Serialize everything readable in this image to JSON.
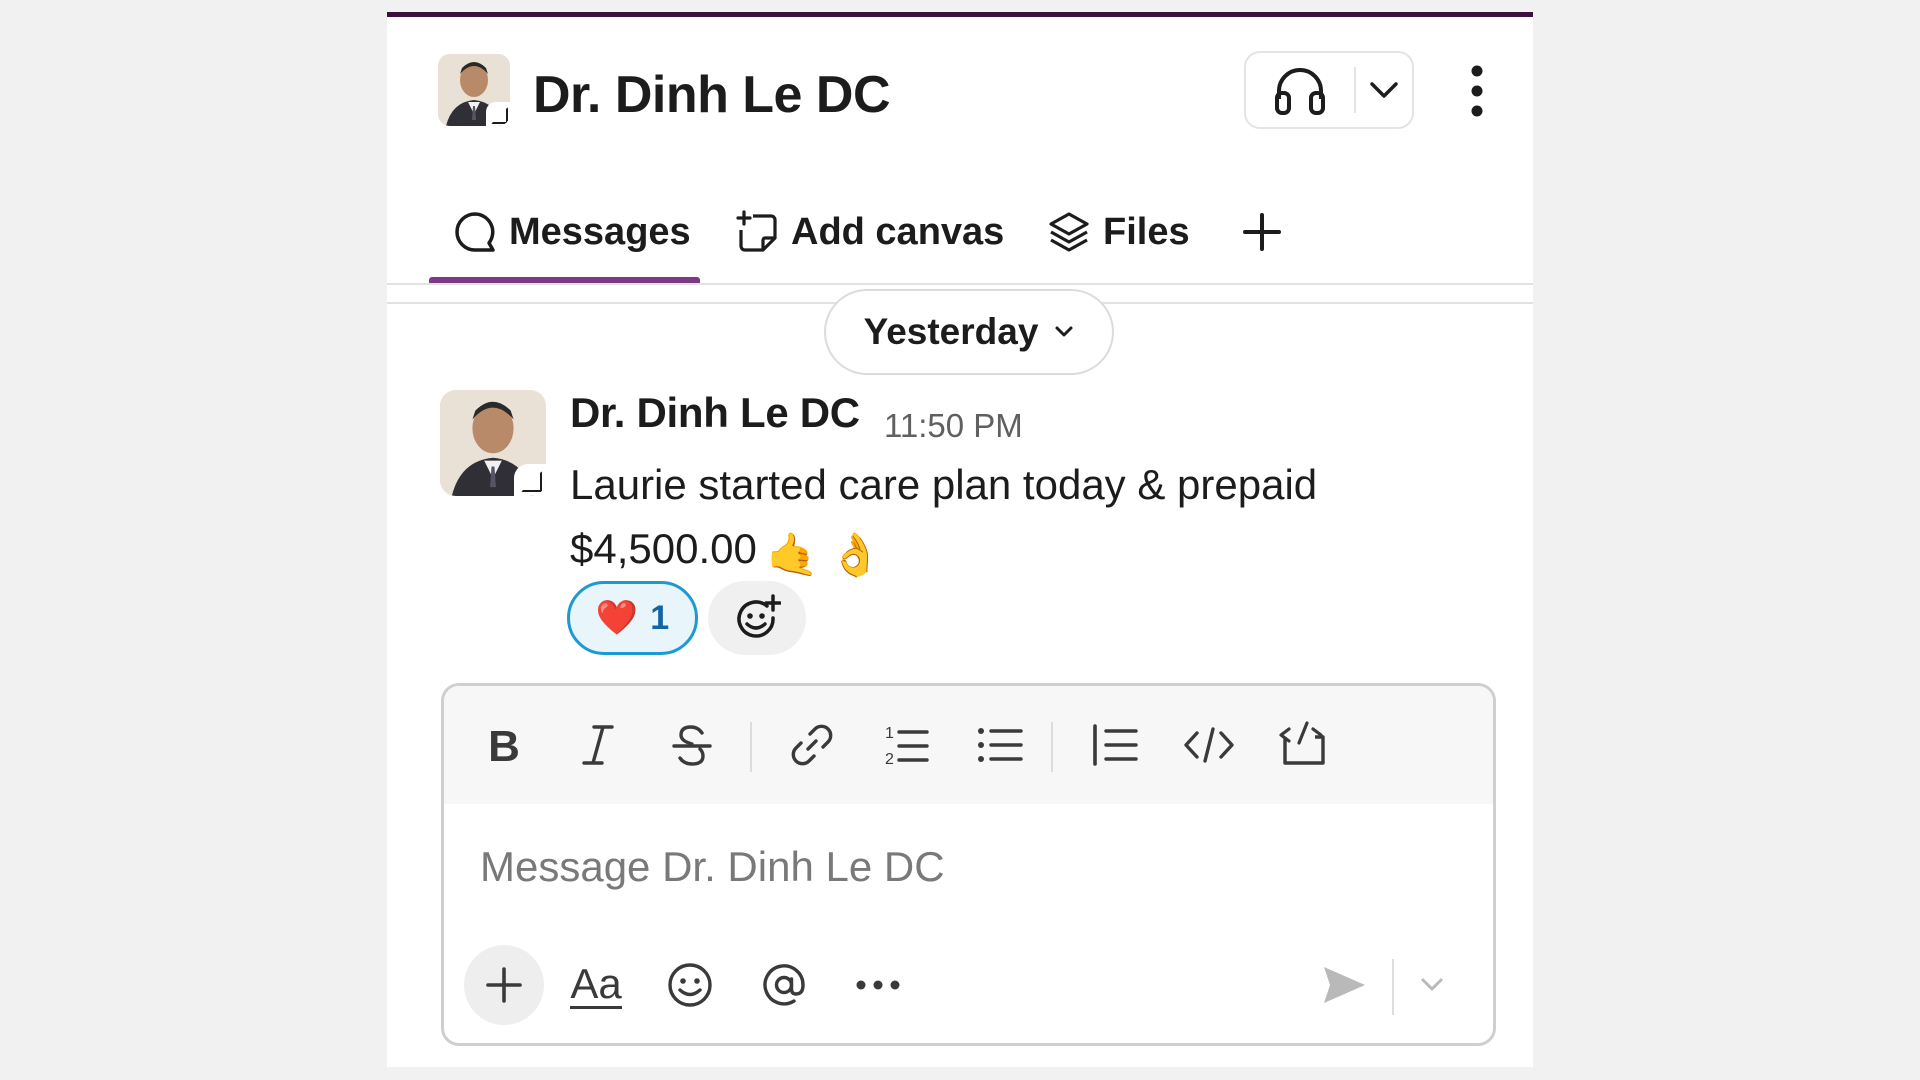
{
  "header": {
    "title": "Dr. Dinh Le DC",
    "avatar_icon": "profile-photo",
    "huddle_icon": "headphones-icon",
    "huddle_dropdown_icon": "chevron-down-icon",
    "more_icon": "vertical-ellipsis-icon"
  },
  "tabs": [
    {
      "label": "Messages",
      "icon": "message-bubble-icon",
      "active": true
    },
    {
      "label": "Add canvas",
      "icon": "canvas-plus-icon",
      "active": false
    },
    {
      "label": "Files",
      "icon": "layers-icon",
      "active": false
    }
  ],
  "add_tab_icon": "plus-icon",
  "date_divider": {
    "label": "Yesterday",
    "icon": "chevron-down-icon"
  },
  "message": {
    "sender": "Dr. Dinh Le DC",
    "timestamp": "11:50 PM",
    "text_line1": "Laurie started care plan today & prepaid",
    "text_line2": "$4,500.00",
    "emojis": [
      "🤙",
      "👌"
    ],
    "reactions": [
      {
        "emoji": "❤️",
        "count": "1"
      }
    ],
    "add_reaction_icon": "add-reaction-icon"
  },
  "composer": {
    "placeholder": "Message Dr. Dinh Le DC",
    "value": "",
    "toolbar": [
      "bold-icon",
      "italic-icon",
      "strikethrough-icon",
      "link-icon",
      "ordered-list-icon",
      "bulleted-list-icon",
      "blockquote-icon",
      "code-icon",
      "code-block-icon"
    ],
    "format_label": "Aa",
    "bottom_icons": [
      "plus-icon",
      "format-icon",
      "emoji-icon",
      "mention-icon",
      "more-icon",
      "send-icon",
      "chevron-down-icon"
    ]
  },
  "colors": {
    "accent": "#7c3a82",
    "top_bar": "#3f0e40",
    "reaction_border": "#1d9bd1",
    "reaction_bg": "#e8f5fa",
    "text": "#1d1c1d"
  }
}
